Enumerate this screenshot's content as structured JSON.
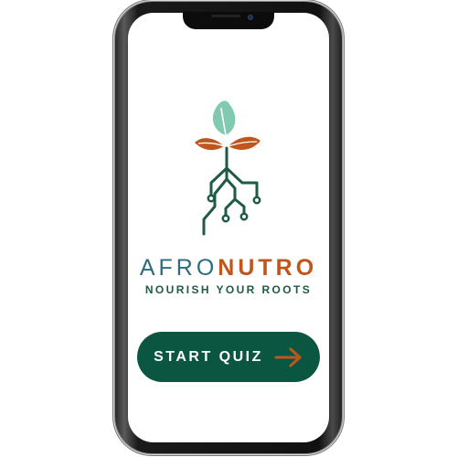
{
  "brand": {
    "name_part1": "AFRO",
    "name_part2": "NUTRO",
    "tagline": "NOURISH YOUR ROOTS"
  },
  "start_button": {
    "label": "START QUIZ",
    "icon": "arrow-right-icon"
  },
  "logo": {
    "icon": "sprout-roots-logo"
  },
  "colors": {
    "primary_green": "#0b5640",
    "accent_orange": "#c0561c",
    "teal_text": "#2e6a80",
    "leaf_mint": "#7fcab0",
    "root_green": "#1e5a45"
  }
}
